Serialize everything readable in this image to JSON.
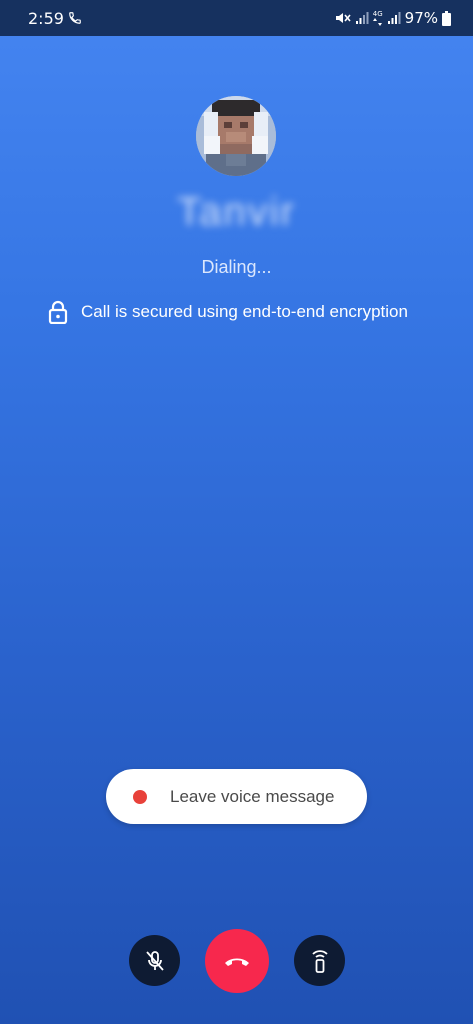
{
  "status_bar": {
    "time": "2:59",
    "network_label": "4G",
    "battery": "97%",
    "icons": [
      "phone-call-icon",
      "mute-vibrate-icon",
      "signal-icon",
      "data-arrows-icon",
      "signal-icon",
      "battery-icon"
    ]
  },
  "contact": {
    "name": "Tanvir",
    "avatar": "contact-avatar"
  },
  "call": {
    "status": "Dialing...",
    "encryption_text": "Call is secured using end-to-end encryption"
  },
  "voice_message": {
    "label": "Leave voice message",
    "dot_color": "#e8413a"
  },
  "controls": {
    "mute_icon": "mic-off-icon",
    "end_call_icon": "end-call-icon",
    "audio_icon": "earpiece-icon",
    "end_call_color": "#f7284d"
  },
  "colors": {
    "background_top": "#4585f1",
    "background_bottom": "#2051b3",
    "status_bar": "#16315f"
  }
}
